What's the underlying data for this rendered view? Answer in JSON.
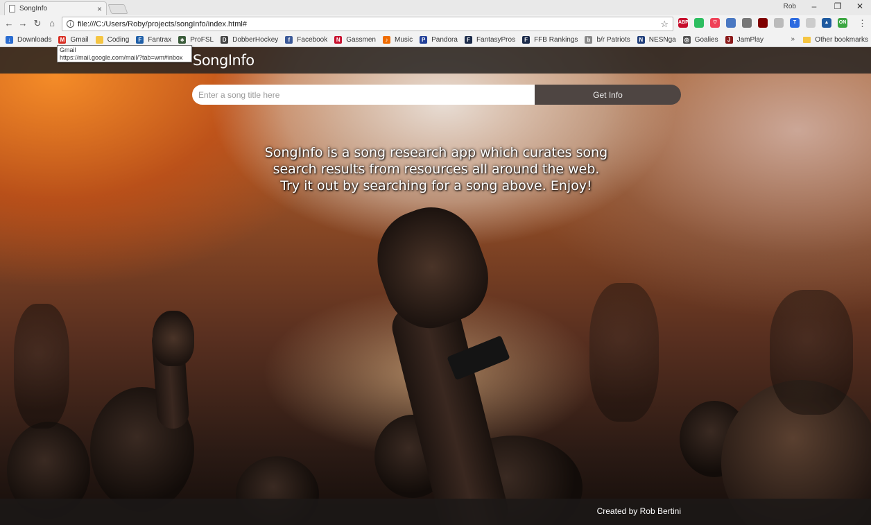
{
  "browser": {
    "tab_title": "SongInfo",
    "tab_close": "×",
    "profile_name": "Rob",
    "window_controls": [
      "–",
      "❐",
      "✕"
    ],
    "nav_back": "←",
    "nav_forward": "→",
    "nav_reload": "↻",
    "nav_home": "⌂",
    "url": "file:///C:/Users/Roby/projects/songInfo/index.html#",
    "bookmark_star": "☆",
    "menu": "⋮",
    "extensions": [
      {
        "name": "abp-icon",
        "label": "ABP",
        "color": "#c70d2c"
      },
      {
        "name": "evernote-icon",
        "label": "",
        "color": "#2dbe60"
      },
      {
        "name": "pocket-icon",
        "label": "♡",
        "color": "#ef4056"
      },
      {
        "name": "calendar-icon",
        "label": "",
        "color": "#4a78c2"
      },
      {
        "name": "cast-icon",
        "label": "",
        "color": "#777777"
      },
      {
        "name": "ublock-icon",
        "label": "",
        "color": "#800000"
      },
      {
        "name": "extension-icon",
        "label": "",
        "color": "#bbbbbb"
      },
      {
        "name": "t-icon",
        "label": "T",
        "color": "#2d6be0"
      },
      {
        "name": "circle-icon",
        "label": "",
        "color": "#cccccc"
      },
      {
        "name": "drive-icon",
        "label": "▲",
        "color": "#1e5aa0"
      },
      {
        "name": "green-icon",
        "label": "ON",
        "color": "#3ba641"
      }
    ],
    "bookmarks": [
      {
        "name": "downloads",
        "label": "Downloads",
        "icon": "↓",
        "color": "#2b6dd1"
      },
      {
        "name": "gmail",
        "label": "Gmail",
        "icon": "M",
        "color": "#d93025"
      },
      {
        "name": "coding",
        "label": "Coding",
        "icon": "",
        "color": "#f5c542"
      },
      {
        "name": "fantrax",
        "label": "Fantrax",
        "icon": "F",
        "color": "#1f5fa8"
      },
      {
        "name": "profsl",
        "label": "ProFSL",
        "icon": "♣",
        "color": "#3b5d3b"
      },
      {
        "name": "dobberhockey",
        "label": "DobberHockey",
        "icon": "D",
        "color": "#444444"
      },
      {
        "name": "facebook",
        "label": "Facebook",
        "icon": "f",
        "color": "#3b5998"
      },
      {
        "name": "gassmen",
        "label": "Gassmen",
        "icon": "N",
        "color": "#c8102e"
      },
      {
        "name": "music",
        "label": "Music",
        "icon": "♪",
        "color": "#ef6c00"
      },
      {
        "name": "pandora",
        "label": "Pandora",
        "icon": "P",
        "color": "#224099"
      },
      {
        "name": "fantasypros",
        "label": "FantasyPros",
        "icon": "F",
        "color": "#1c2b4a"
      },
      {
        "name": "ffb-rankings",
        "label": "FFB Rankings",
        "icon": "F",
        "color": "#1c2b4a"
      },
      {
        "name": "br-patriots",
        "label": "b/r Patriots",
        "icon": "b",
        "color": "#888888"
      },
      {
        "name": "nesnga",
        "label": "NESNga",
        "icon": "N",
        "color": "#1f3d7a"
      },
      {
        "name": "goalies",
        "label": "Goalies",
        "icon": "◎",
        "color": "#555555"
      },
      {
        "name": "jamplay",
        "label": "JamPlay",
        "icon": "J",
        "color": "#8b1a1a"
      }
    ],
    "bookmarks_overflow": "»",
    "other_bookmarks": "Other bookmarks",
    "tooltip": {
      "title": "Gmail",
      "url": "https://mail.google.com/mail/?tab=wm#inbox"
    }
  },
  "page": {
    "brand": "SongInfo",
    "search": {
      "placeholder": "Enter a song title here",
      "value": "",
      "button_label": "Get Info"
    },
    "intro_lines": [
      "SongInfo is a song research app which curates song",
      "search results from resources all around the web.",
      "Try it out by searching for a song above. Enjoy!"
    ],
    "footer_credit": "Created by Rob Bertini"
  }
}
